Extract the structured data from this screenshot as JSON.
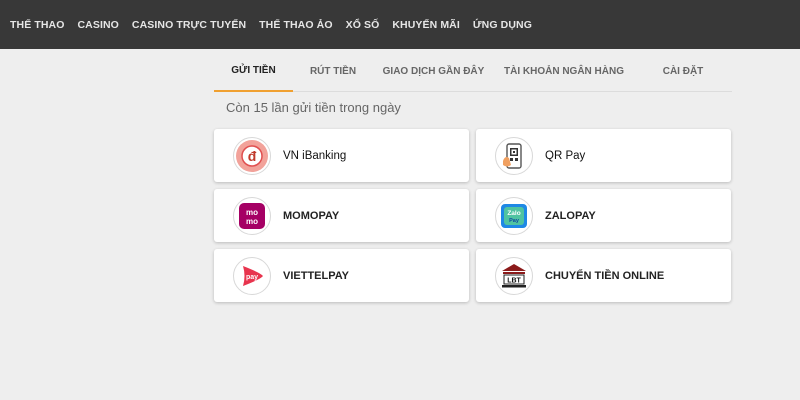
{
  "nav": {
    "items": [
      "THỂ THAO",
      "CASINO",
      "CASINO TRỰC TUYẾN",
      "THỂ THAO ẢO",
      "XỔ SỐ",
      "KHUYẾN MÃI",
      "ỨNG DỤNG"
    ]
  },
  "tabs": {
    "items": [
      "GỬI TIỀN",
      "RÚT TIỀN",
      "GIAO DỊCH GẦN ĐÂY",
      "TÀI KHOẢN NGÂN HÀNG",
      "CÀI ĐẶT"
    ],
    "active": "GỬI TIỀN"
  },
  "deposit": {
    "notice": "Còn 15 lần gửi tiền trong ngày",
    "methods": [
      {
        "label": "VN iBanking",
        "icon": "vn-ibanking-icon",
        "icon_text": "đ"
      },
      {
        "label": "QR Pay",
        "icon": "qr-pay-icon"
      },
      {
        "label": "MOMOPAY",
        "icon": "momo-icon",
        "icon_text": "mo mo"
      },
      {
        "label": "ZALOPAY",
        "icon": "zalopay-icon",
        "icon_text": "Zalo"
      },
      {
        "label": "VIETTELPAY",
        "icon": "viettelpay-icon",
        "icon_text": "pay"
      },
      {
        "label": "CHUYỂN TIỀN ONLINE",
        "icon": "bank-transfer-icon",
        "icon_text": "LBT"
      }
    ]
  },
  "colors": {
    "nav_bg": "#383838",
    "accent": "#f0a030",
    "page_bg": "#eeeeee"
  }
}
